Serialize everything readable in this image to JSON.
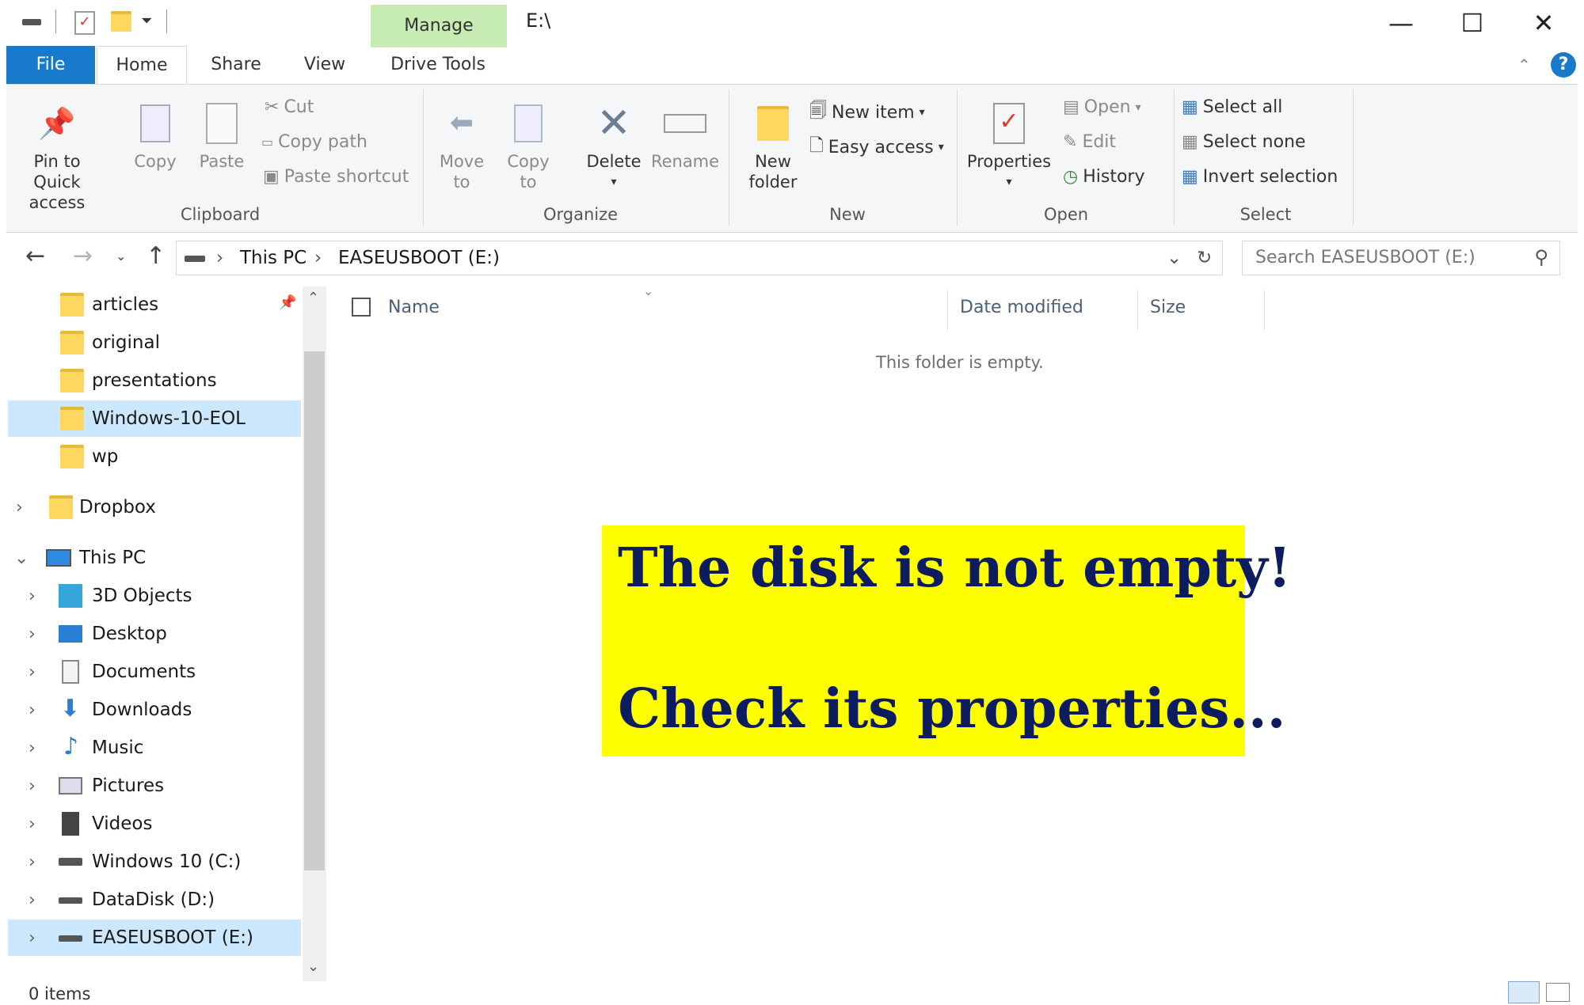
{
  "window": {
    "title": "E:\\",
    "context_tab": "Manage",
    "controls": {
      "minimize": "—",
      "maximize": "☐",
      "close": "✕"
    }
  },
  "tabs": [
    "File",
    "Home",
    "Share",
    "View",
    "Drive Tools"
  ],
  "ribbon": {
    "clipboard": {
      "pin_line1": "Pin to Quick",
      "pin_line2": "access",
      "copy": "Copy",
      "paste": "Paste",
      "cut": "Cut",
      "copy_path": "Copy path",
      "paste_shortcut": "Paste shortcut",
      "label": "Clipboard"
    },
    "organize": {
      "move_line1": "Move",
      "move_line2": "to",
      "copy_line1": "Copy",
      "copy_line2": "to",
      "delete": "Delete",
      "rename": "Rename",
      "label": "Organize"
    },
    "new": {
      "new_folder_line1": "New",
      "new_folder_line2": "folder",
      "new_item": "New item",
      "easy_access": "Easy access",
      "label": "New"
    },
    "open": {
      "properties": "Properties",
      "open": "Open",
      "edit": "Edit",
      "history": "History",
      "label": "Open"
    },
    "select": {
      "select_all": "Select all",
      "select_none": "Select none",
      "invert_selection": "Invert selection",
      "label": "Select"
    }
  },
  "address": {
    "crumbs": [
      "This PC",
      "EASEUSBOOT (E:)"
    ],
    "search_placeholder": "Search EASEUSBOOT (E:)"
  },
  "nav": {
    "quick_access": [
      "articles",
      "original",
      "presentations",
      "Windows-10-EOL",
      "wp"
    ],
    "dropbox": "Dropbox",
    "this_pc": "This PC",
    "pc_items": [
      "3D Objects",
      "Desktop",
      "Documents",
      "Downloads",
      "Music",
      "Pictures",
      "Videos",
      "Windows 10 (C:)",
      "DataDisk (D:)",
      "EASEUSBOOT (E:)"
    ]
  },
  "columns": [
    "Name",
    "Date modified",
    "Size"
  ],
  "empty_message": "This folder is empty.",
  "banner": {
    "line1": "The disk is not empty!",
    "line2": "Check its properties..."
  },
  "status": {
    "items": "0 items"
  },
  "colors": {
    "file_tab": "#1979ca",
    "manage_tab": "#c7ecb4",
    "selection": "#cce8ff",
    "banner_bg": "#ffff00",
    "banner_text": "#0c1c5f"
  }
}
